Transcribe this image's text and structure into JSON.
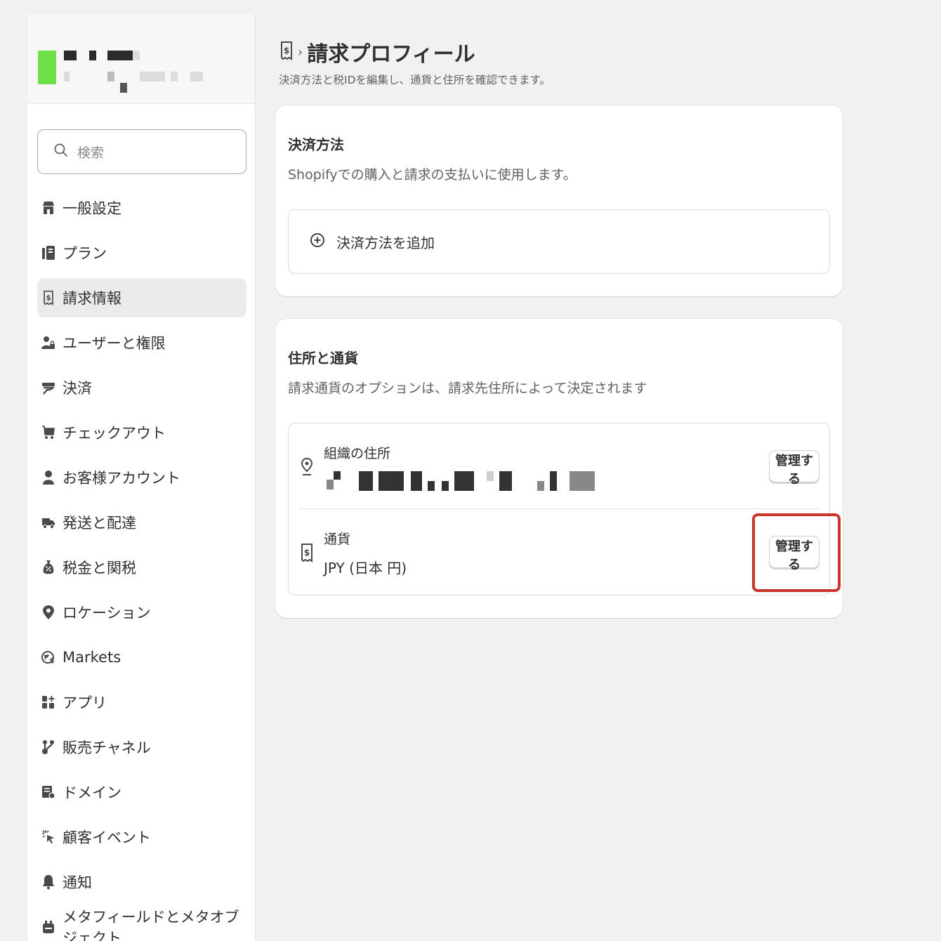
{
  "colors": {
    "background": "#f1f1f1",
    "store_logo": "#6fe04a",
    "highlight": "#c8352b"
  },
  "search": {
    "placeholder": "検索",
    "icon": "search-icon"
  },
  "sidebar": {
    "items": [
      {
        "label": "一般設定",
        "icon": "store-icon",
        "active": false
      },
      {
        "label": "プラン",
        "icon": "plan-icon",
        "active": false
      },
      {
        "label": "請求情報",
        "icon": "receipt-dollar-icon",
        "active": true
      },
      {
        "label": "ユーザーと権限",
        "icon": "users-lock-icon",
        "active": false
      },
      {
        "label": "決済",
        "icon": "payment-icon",
        "active": false
      },
      {
        "label": "チェックアウト",
        "icon": "cart-icon",
        "active": false
      },
      {
        "label": "お客様アカウント",
        "icon": "person-icon",
        "active": false
      },
      {
        "label": "発送と配達",
        "icon": "truck-icon",
        "active": false
      },
      {
        "label": "税金と関税",
        "icon": "tax-bag-icon",
        "active": false
      },
      {
        "label": "ロケーション",
        "icon": "location-pin-icon",
        "active": false
      },
      {
        "label": "Markets",
        "icon": "globe-dollar-icon",
        "active": false
      },
      {
        "label": "アプリ",
        "icon": "apps-icon",
        "active": false
      },
      {
        "label": "販売チャネル",
        "icon": "channels-icon",
        "active": false
      },
      {
        "label": "ドメイン",
        "icon": "domain-icon",
        "active": false
      },
      {
        "label": "顧客イベント",
        "icon": "cursor-click-icon",
        "active": false
      },
      {
        "label": "通知",
        "icon": "bell-icon",
        "active": false
      },
      {
        "label": "メタフィールドとメタオブジェクト",
        "icon": "metafield-icon",
        "active": false
      }
    ]
  },
  "header": {
    "title": "請求プロフィール",
    "subtitle": "決済方法と税IDを編集し、通貨と住所を確認できます。",
    "chevron": "›"
  },
  "payment_card": {
    "title": "決済方法",
    "description": "Shopifyでの購入と請求の支払いに使用します。",
    "add_label": "決済方法を追加"
  },
  "address_card": {
    "title": "住所と通貨",
    "description": "請求通貨のオプションは、請求先住所によって決定されます",
    "address_label": "組織の住所",
    "currency_label": "通貨",
    "currency_value": "JPY (日本 円)",
    "manage_label": "管理する"
  }
}
